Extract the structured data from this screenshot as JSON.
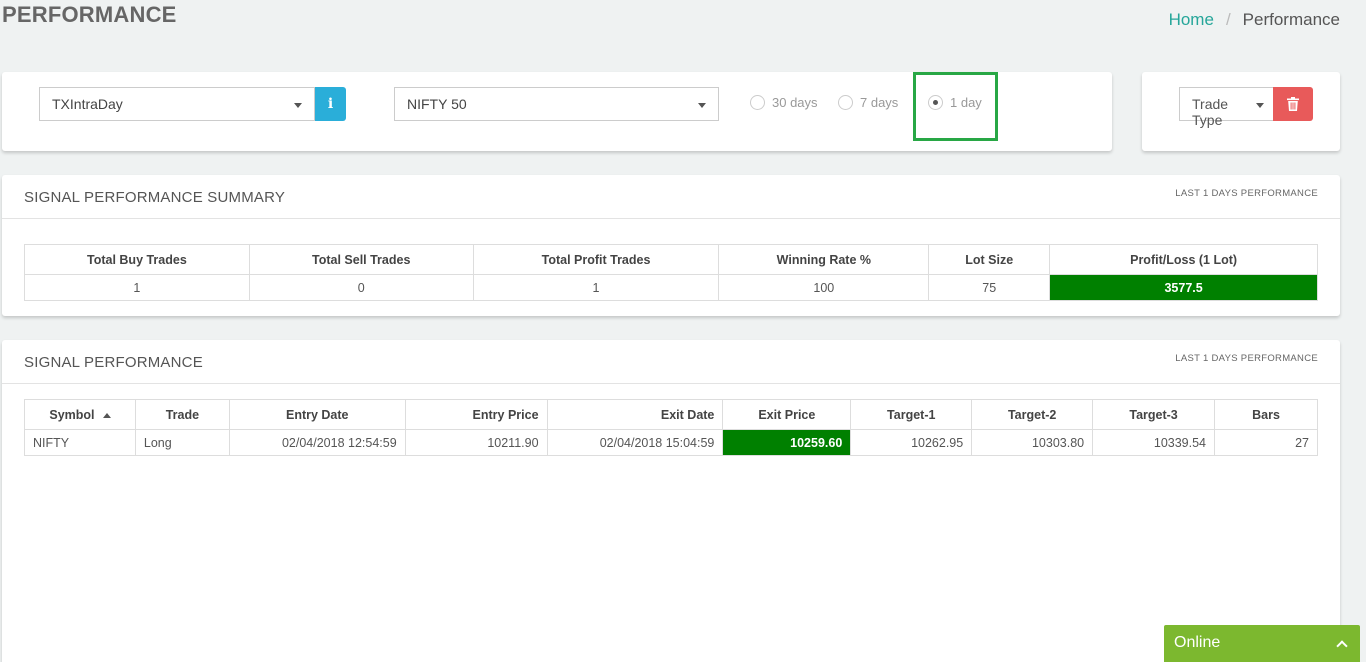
{
  "page": {
    "title": "PERFORMANCE"
  },
  "breadcrumb": {
    "home": "Home",
    "separator": "/",
    "current": "Performance"
  },
  "filters": {
    "strategy": "TXIntraDay",
    "info_icon": "i",
    "symbol": "NIFTY 50",
    "periods": [
      {
        "label": "30 days",
        "checked": false
      },
      {
        "label": "7 days",
        "checked": false
      },
      {
        "label": "1 day",
        "checked": true
      }
    ],
    "trade_type": "Trade Type"
  },
  "summary": {
    "title": "SIGNAL PERFORMANCE SUMMARY",
    "subtitle": "LAST 1 DAYS PERFORMANCE",
    "headers": [
      "Total Buy Trades",
      "Total Sell Trades",
      "Total Profit Trades",
      "Winning Rate %",
      "Lot Size",
      "Profit/Loss (1 Lot)"
    ],
    "values": [
      "1",
      "0",
      "1",
      "100",
      "75",
      "3577.5"
    ]
  },
  "performance": {
    "title": "SIGNAL PERFORMANCE",
    "subtitle": "LAST 1 DAYS PERFORMANCE",
    "headers": [
      "Symbol",
      "Trade",
      "Entry Date",
      "Entry Price",
      "Exit Date",
      "Exit Price",
      "Target-1",
      "Target-2",
      "Target-3",
      "Bars"
    ],
    "rows": [
      [
        "NIFTY",
        "Long",
        "02/04/2018 12:54:59",
        "10211.90",
        "02/04/2018 15:04:59",
        "10259.60",
        "10262.95",
        "10303.80",
        "10339.54",
        "27"
      ]
    ]
  },
  "online": {
    "label": "Online"
  },
  "colors": {
    "accent": "#26a69a",
    "profit": "#008000",
    "info": "#2aaed9",
    "danger": "#e85a5a",
    "online": "#7cb82f",
    "highlight": "#28a745"
  }
}
